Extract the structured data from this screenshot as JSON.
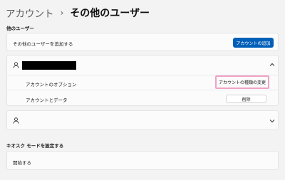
{
  "breadcrumb": {
    "parent": "アカウント",
    "separator": "›",
    "current": "その他のユーザー"
  },
  "other_users": {
    "section_label": "他のユーザー",
    "add_row_label": "その他のユーザーを追加する",
    "add_button_label": "アカウントの追加",
    "accent_color": "#005fb8"
  },
  "user_expanded": {
    "icon": "person-icon",
    "chevron": "chevron-up-icon",
    "account_options_label": "アカウントのオプション",
    "change_type_button_label": "アカウントの種類の変更",
    "account_data_label": "アカウントとデータ",
    "remove_button_label": "削除",
    "highlight_color": "#f0a2c4"
  },
  "user_collapsed": {
    "icon": "person-icon",
    "chevron": "chevron-down-icon"
  },
  "kiosk": {
    "section_label": "キオスク モードを設定する",
    "start_label": "開始する"
  }
}
